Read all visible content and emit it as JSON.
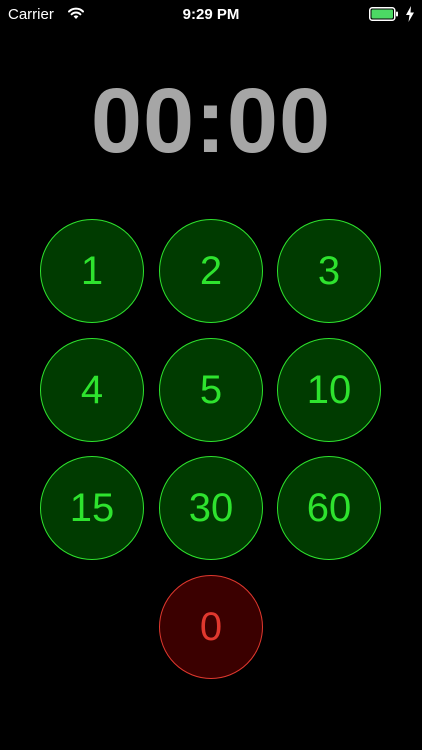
{
  "status_bar": {
    "carrier": "Carrier",
    "time": "9:29 PM",
    "icons": [
      "wifi-icon",
      "battery-icon",
      "charging-bolt-icon"
    ]
  },
  "timer": {
    "display": "00:00",
    "color": "#a6a6a6"
  },
  "keypad": {
    "keys": [
      {
        "label": "1"
      },
      {
        "label": "2"
      },
      {
        "label": "3"
      },
      {
        "label": "4"
      },
      {
        "label": "5"
      },
      {
        "label": "10"
      },
      {
        "label": "15"
      },
      {
        "label": "30"
      },
      {
        "label": "60"
      }
    ],
    "reset_key": {
      "label": "0"
    },
    "colors": {
      "key_fill": "#003b00",
      "key_stroke": "#2ee32e",
      "reset_fill": "#3b0000",
      "reset_stroke": "#e0382e"
    }
  }
}
